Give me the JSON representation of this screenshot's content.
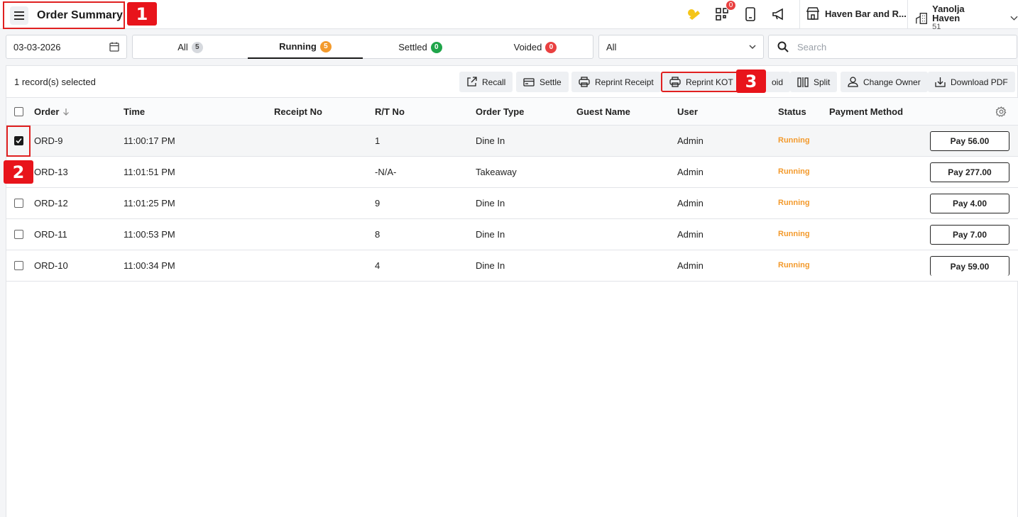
{
  "header": {
    "title": "Order Summary",
    "notification_count": "0",
    "store_name": "Haven Bar and R...",
    "account_name": "Yanolja Haven",
    "account_sub": "51"
  },
  "callouts": [
    "1",
    "2",
    "3"
  ],
  "filters": {
    "date": "03-03-2026",
    "tabs": [
      {
        "label": "All",
        "count": "5"
      },
      {
        "label": "Running",
        "count": "5"
      },
      {
        "label": "Settled",
        "count": "0"
      },
      {
        "label": "Voided",
        "count": "0"
      }
    ],
    "active_tab": "Running",
    "select_value": "All",
    "search_placeholder": "Search"
  },
  "toolbar": {
    "selection_text": "1 record(s) selected",
    "buttons": [
      "Recall",
      "Settle",
      "Reprint Receipt",
      "Reprint KOT",
      "Void",
      "Split",
      "Change Owner",
      "Download PDF"
    ],
    "void_visible": "oid"
  },
  "table": {
    "columns": [
      "Order",
      "Time",
      "Receipt No",
      "R/T No",
      "Order Type",
      "Guest Name",
      "User",
      "Status",
      "Payment Method"
    ],
    "rows": [
      {
        "order": "ORD-9",
        "time": "11:00:17 PM",
        "receipt": "",
        "rt": "1",
        "type": "Dine In",
        "guest": "",
        "user": "Admin",
        "status": "Running",
        "pay": "Pay 56.00",
        "checked": true
      },
      {
        "order": "ORD-13",
        "time": "11:01:51 PM",
        "receipt": "",
        "rt": "-N/A-",
        "type": "Takeaway",
        "guest": "",
        "user": "Admin",
        "status": "Running",
        "pay": "Pay 277.00",
        "checked": false
      },
      {
        "order": "ORD-12",
        "time": "11:01:25 PM",
        "receipt": "",
        "rt": "9",
        "type": "Dine In",
        "guest": "",
        "user": "Admin",
        "status": "Running",
        "pay": "Pay 4.00",
        "checked": false
      },
      {
        "order": "ORD-11",
        "time": "11:00:53 PM",
        "receipt": "",
        "rt": "8",
        "type": "Dine In",
        "guest": "",
        "user": "Admin",
        "status": "Running",
        "pay": "Pay 7.00",
        "checked": false
      },
      {
        "order": "ORD-10",
        "time": "11:00:34 PM",
        "receipt": "",
        "rt": "4",
        "type": "Dine In",
        "guest": "",
        "user": "Admin",
        "status": "Running",
        "pay": "Pay 59.00",
        "checked": false
      }
    ]
  },
  "colors": {
    "accent_running": "#f39a2c",
    "settled": "#1fa54a",
    "voided": "#e94040",
    "highlight": "#e02020"
  }
}
